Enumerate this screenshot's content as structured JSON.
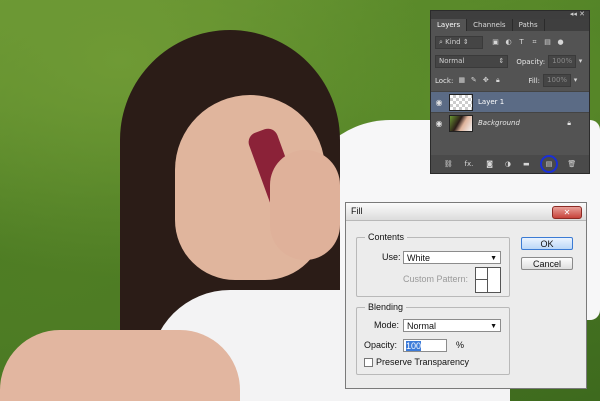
{
  "layers_panel": {
    "panel_controls": "◂◂ ✕",
    "tabs": [
      "Layers",
      "Channels",
      "Paths"
    ],
    "kind_label": "Kind",
    "blend_mode": "Normal",
    "opacity_label": "Opacity:",
    "opacity_value": "100%",
    "lock_label": "Lock:",
    "fill_label": "Fill:",
    "fill_value": "100%",
    "layers": [
      {
        "name": "Layer 1",
        "selected": true
      },
      {
        "name": "Background",
        "selected": false
      }
    ],
    "bottom_icons": [
      "link-icon",
      "fx-icon",
      "mask-icon",
      "adjustment-icon",
      "folder-icon",
      "new-layer-icon",
      "trash-icon"
    ],
    "fx_label": "fx."
  },
  "fill_dialog": {
    "title": "Fill",
    "close_label": "✕",
    "contents_label": "Contents",
    "use_label": "Use:",
    "use_value": "White",
    "custom_pattern_label": "Custom Pattern:",
    "blending_label": "Blending",
    "mode_label": "Mode:",
    "mode_value": "Normal",
    "opacity_label": "Opacity:",
    "opacity_value": "100",
    "percent": "%",
    "preserve_label": "Preserve Transparency",
    "ok_label": "OK",
    "cancel_label": "Cancel"
  },
  "colors": {
    "panel_bg": "#535353",
    "selected_layer": "#5b6b85",
    "highlight_circle": "#1a2fd6",
    "dialog_bg": "#ececec"
  }
}
